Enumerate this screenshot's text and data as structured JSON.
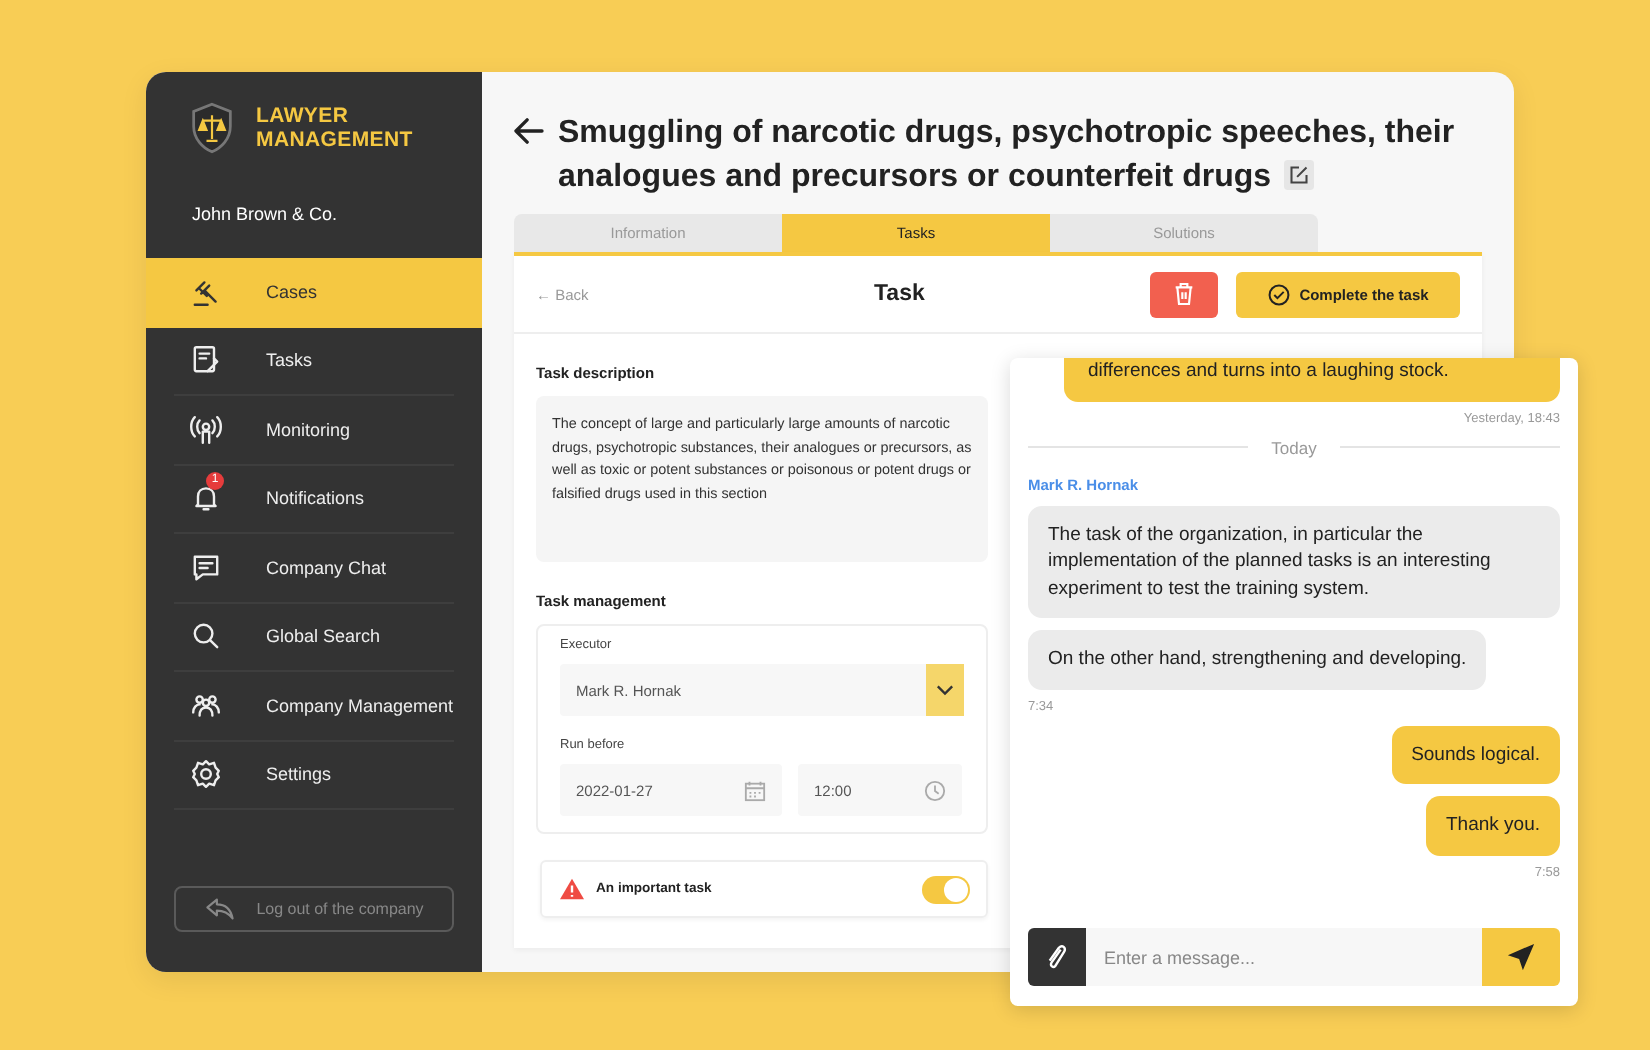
{
  "sidebar": {
    "logo_text": "LAWYER MANAGEMENT",
    "company": "John Brown & Co.",
    "items": [
      {
        "label": "Cases",
        "selected": true
      },
      {
        "label": "Tasks",
        "selected": false
      },
      {
        "label": "Monitoring",
        "selected": false
      },
      {
        "label": "Notifications",
        "selected": false,
        "badge": "1"
      },
      {
        "label": "Company Chat",
        "selected": false
      },
      {
        "label": "Global Search",
        "selected": false
      },
      {
        "label": "Company Management",
        "selected": false
      },
      {
        "label": "Settings",
        "selected": false
      }
    ],
    "logout": "Log out of the company"
  },
  "header": {
    "title": "Smuggling of narcotic drugs, psychotropic speeches, their analogues and precursors or counterfeit drugs"
  },
  "tabs": [
    {
      "label": "Information",
      "selected": false
    },
    {
      "label": "Tasks",
      "selected": true
    },
    {
      "label": "Solutions",
      "selected": false
    }
  ],
  "task": {
    "back": "← Back",
    "title": "Task",
    "complete": "Complete the task",
    "description_label": "Task description",
    "description": "The concept of large and particularly large amounts of narcotic drugs, psychotropic substances, their analogues or precursors, as well as toxic or potent substances or poisonous or potent drugs or falsified drugs used in this section",
    "management_label": "Task management",
    "executor_label": "Executor",
    "executor": "Mark R. Hornak",
    "run_before_label": "Run before",
    "date": "2022-01-27",
    "time": "12:00",
    "important": {
      "label": "An important task",
      "on": true
    }
  },
  "chat": {
    "messages": [
      {
        "kind": "outgoing",
        "text": "differences and turns into a laughing stock.",
        "cut": true
      },
      {
        "kind": "time_out",
        "text": "Yesterday, 18:43"
      },
      {
        "kind": "divider",
        "text": "Today"
      },
      {
        "kind": "sender",
        "text": "Mark R. Hornak"
      },
      {
        "kind": "incoming",
        "text": "The task of the organization, in particular the implementation of the planned tasks is an interesting experiment to test the training system."
      },
      {
        "kind": "incoming",
        "text": "On the other hand, strengthening and developing."
      },
      {
        "kind": "time_in",
        "text": "7:34"
      },
      {
        "kind": "outgoing",
        "text": "Sounds logical.",
        "cut": false
      },
      {
        "kind": "outgoing",
        "text": "Thank you.",
        "cut": false
      },
      {
        "kind": "time_out",
        "text": "7:58"
      }
    ],
    "placeholder": "Enter a message..."
  }
}
